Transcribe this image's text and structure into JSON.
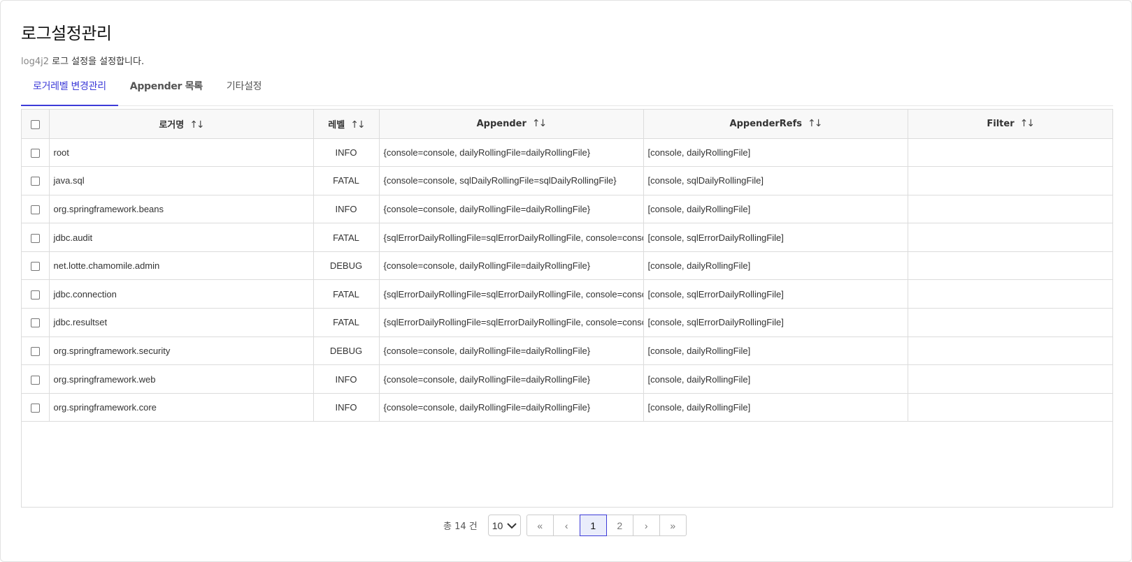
{
  "header": {
    "title": "로그설정관리",
    "subtitle_prefix": "log4j2",
    "subtitle_text": " 로그 설정을 설정합니다."
  },
  "tabs": [
    {
      "label": "로거레벨 변경관리",
      "active": true
    },
    {
      "label": "Appender 목록",
      "active": false
    },
    {
      "label": "기타설정",
      "active": false
    }
  ],
  "table": {
    "columns": [
      "로거명",
      "레벨",
      "Appender",
      "AppenderRefs",
      "Filter"
    ],
    "sort_glyph": "↑↓",
    "rows": [
      {
        "name": "root",
        "level": "INFO",
        "appender": "{console=console, dailyRollingFile=dailyRollingFile}",
        "refs": "[console, dailyRollingFile]",
        "filter": ""
      },
      {
        "name": "java.sql",
        "level": "FATAL",
        "appender": "{console=console, sqlDailyRollingFile=sqlDailyRollingFile}",
        "refs": "[console, sqlDailyRollingFile]",
        "filter": ""
      },
      {
        "name": "org.springframework.beans",
        "level": "INFO",
        "appender": "{console=console, dailyRollingFile=dailyRollingFile}",
        "refs": "[console, dailyRollingFile]",
        "filter": ""
      },
      {
        "name": "jdbc.audit",
        "level": "FATAL",
        "appender": "{sqlErrorDailyRollingFile=sqlErrorDailyRollingFile, console=console}",
        "refs": "[console, sqlErrorDailyRollingFile]",
        "filter": ""
      },
      {
        "name": "net.lotte.chamomile.admin",
        "level": "DEBUG",
        "appender": "{console=console, dailyRollingFile=dailyRollingFile}",
        "refs": "[console, dailyRollingFile]",
        "filter": ""
      },
      {
        "name": "jdbc.connection",
        "level": "FATAL",
        "appender": "{sqlErrorDailyRollingFile=sqlErrorDailyRollingFile, console=console}",
        "refs": "[console, sqlErrorDailyRollingFile]",
        "filter": ""
      },
      {
        "name": "jdbc.resultset",
        "level": "FATAL",
        "appender": "{sqlErrorDailyRollingFile=sqlErrorDailyRollingFile, console=console}",
        "refs": "[console, sqlErrorDailyRollingFile]",
        "filter": ""
      },
      {
        "name": "org.springframework.security",
        "level": "DEBUG",
        "appender": "{console=console, dailyRollingFile=dailyRollingFile}",
        "refs": "[console, dailyRollingFile]",
        "filter": ""
      },
      {
        "name": "org.springframework.web",
        "level": "INFO",
        "appender": "{console=console, dailyRollingFile=dailyRollingFile}",
        "refs": "[console, dailyRollingFile]",
        "filter": ""
      },
      {
        "name": "org.springframework.core",
        "level": "INFO",
        "appender": "{console=console, dailyRollingFile=dailyRollingFile}",
        "refs": "[console, dailyRollingFile]",
        "filter": ""
      }
    ]
  },
  "pagination": {
    "total_label": "총 14 건",
    "page_size": "10",
    "first_glyph": "«",
    "prev_glyph": "‹",
    "next_glyph": "›",
    "last_glyph": "»",
    "pages": [
      "1",
      "2"
    ],
    "current_page": "1"
  },
  "colors": {
    "accent": "#3d3bd8",
    "header_bg": "#f8f8f8",
    "border": "#dcdcdc"
  }
}
